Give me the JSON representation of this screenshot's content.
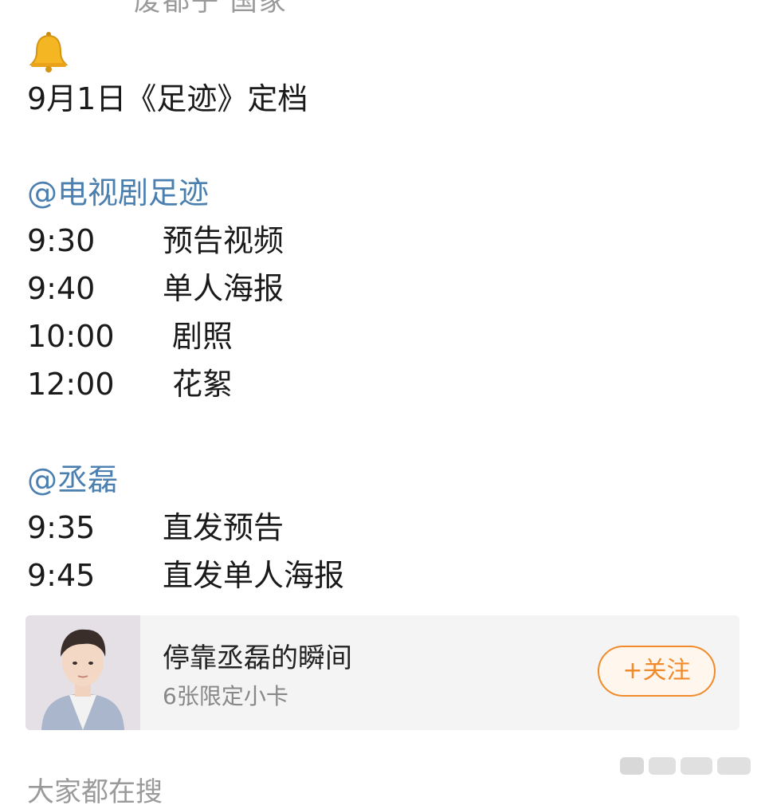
{
  "post": {
    "top_cut_text": "废都子 国家",
    "bell_icon": "bell-icon",
    "headline": "9月1日《足迹》定档",
    "sections": [
      {
        "mention": "@电视剧足迹",
        "rows": [
          {
            "time": "9:30",
            "item": "预告视频"
          },
          {
            "time": "9:40",
            "item": "单人海报"
          },
          {
            "time": "10:00",
            "item": "剧照"
          },
          {
            "time": "12:00",
            "item": "花絮"
          }
        ]
      },
      {
        "mention": "@丞磊",
        "rows": [
          {
            "time": "9:35",
            "item": "直发预告"
          },
          {
            "time": "9:45",
            "item": "直发单人海报"
          }
        ]
      }
    ]
  },
  "card": {
    "title": "停靠丞磊的瞬间",
    "subtitle": "6张限定小卡",
    "follow_label": "+关注",
    "accent_color": "#f08a2a"
  },
  "footer": {
    "bottom_cut_text": "大家都在搜"
  },
  "colors": {
    "mention": "#4a7fb0",
    "text": "#1a1a1a"
  }
}
